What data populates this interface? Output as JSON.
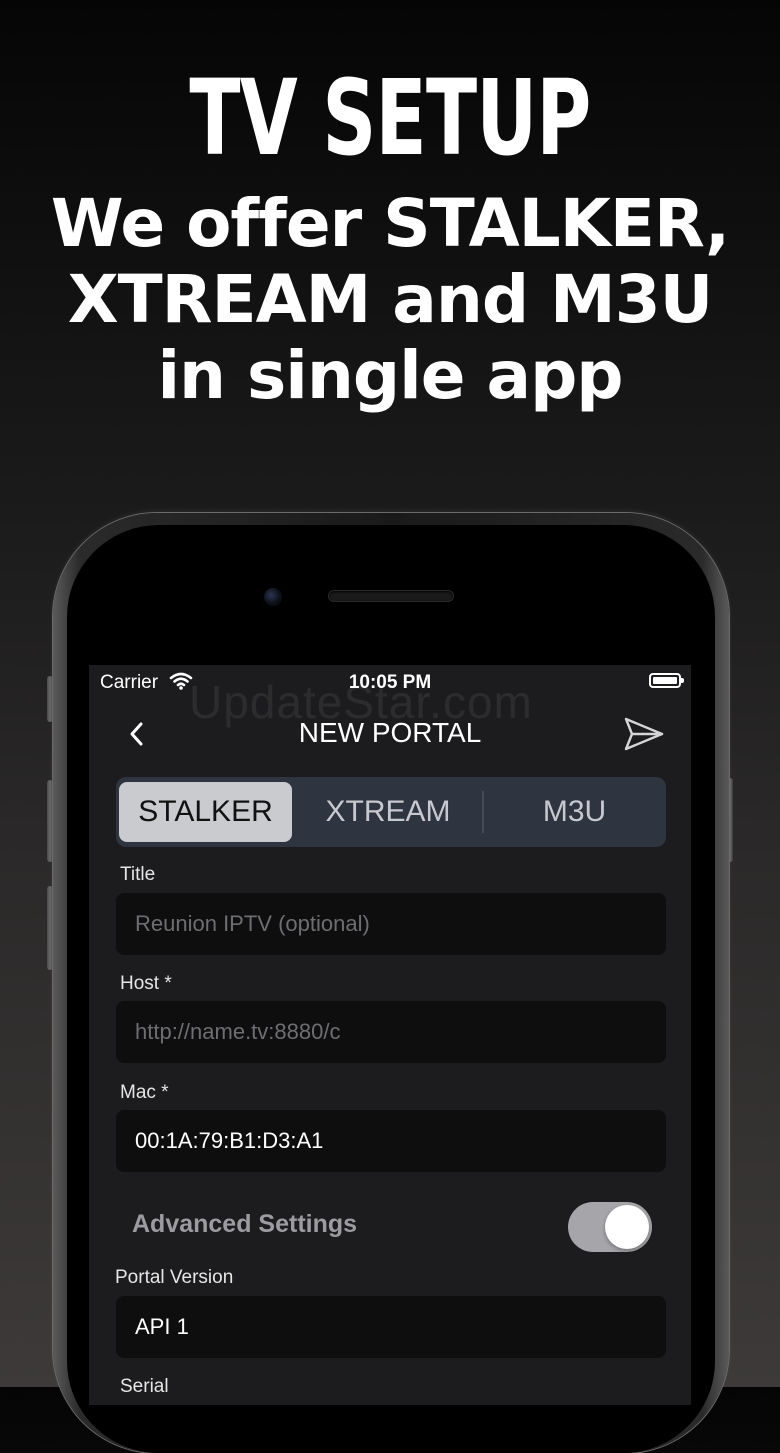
{
  "hero": {
    "title": "TV SETUP",
    "subtitle": "We offer STALKER, XTREAM and M3U in single app"
  },
  "status_bar": {
    "carrier": "Carrier",
    "time": "10:05 PM",
    "wifi_icon": "wifi-icon",
    "battery_icon": "battery-icon"
  },
  "watermark": "UpdateStar.com",
  "nav": {
    "title": "NEW PORTAL",
    "back_icon": "chevron-left-icon",
    "send_icon": "paper-plane-icon"
  },
  "segmented": {
    "options": [
      "STALKER",
      "XTREAM",
      "M3U"
    ],
    "selected": "STALKER"
  },
  "form": {
    "title_label": "Title",
    "title_placeholder": "Reunion IPTV (optional)",
    "host_label": "Host *",
    "host_placeholder": "http://name.tv:8880/c",
    "mac_label": "Mac *",
    "mac_value": "00:1A:79:B1:D3:A1",
    "advanced_label": "Advanced Settings",
    "advanced_enabled": true,
    "portal_version_label": "Portal Version",
    "portal_version_value": "API 1",
    "serial_label": "Serial"
  },
  "colors": {
    "accent_toggle": "#a6a6aa",
    "segment_active": "#c9cbcf",
    "segment_bg": "#2e3440",
    "field_bg": "#0e0e0f"
  }
}
